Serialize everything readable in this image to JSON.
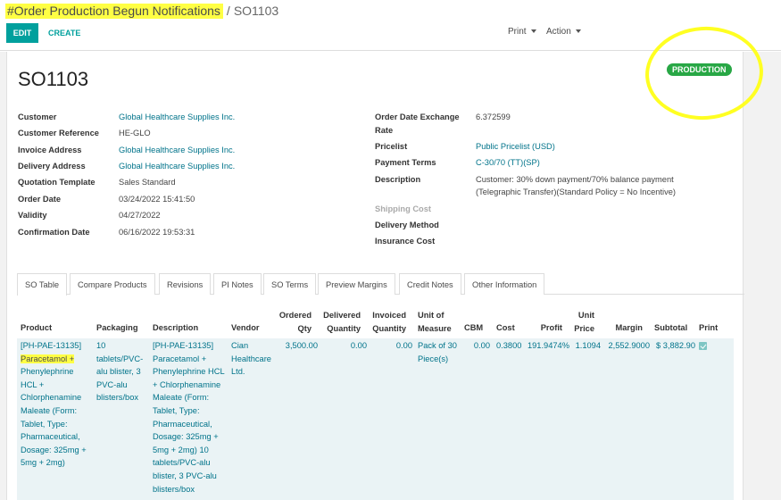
{
  "breadcrumb": {
    "parent": "#Order Production Begun Notifications",
    "separator": "/",
    "current": "SO1103"
  },
  "toolbar": {
    "edit_label": "EDIT",
    "create_label": "CREATE",
    "print_label": "Print",
    "action_label": "Action"
  },
  "record": {
    "name": "SO1103",
    "status": "PRODUCTION",
    "left_fields": [
      {
        "label": "Customer",
        "value": "Global Healthcare Supplies Inc."
      },
      {
        "label": "Customer Reference",
        "value": "HE-GLO"
      },
      {
        "label": "Invoice Address",
        "value": "Global Healthcare Supplies Inc."
      },
      {
        "label": "Delivery Address",
        "value": "Global Healthcare Supplies Inc."
      },
      {
        "label": "Quotation Template",
        "value": "Sales Standard"
      },
      {
        "label": "Order Date",
        "value": "03/24/2022 15:41:50"
      },
      {
        "label": "Validity",
        "value": "04/27/2022"
      },
      {
        "label": "Confirmation Date",
        "value": "06/16/2022 19:53:31"
      }
    ],
    "right_fields": {
      "exchange_rate": {
        "label_line1": "Order Date Exchange",
        "label_line2": "Rate",
        "value": "6.372599"
      },
      "pricelist": {
        "label": "Pricelist",
        "value": "Public Pricelist (USD)"
      },
      "payment_terms": {
        "label": "Payment Terms",
        "value": "C-30/70 (TT)(SP)"
      },
      "description": {
        "label": "Description",
        "line1": "Customer: 30% down payment/70% balance payment",
        "line2": "(Telegraphic Transfer)(Standard Policy = No Incentive)"
      },
      "shipping_cost": {
        "label": "Shipping Cost"
      },
      "delivery_method": {
        "label": "Delivery Method"
      },
      "insurance_cost": {
        "label": "Insurance Cost"
      }
    }
  },
  "tabs": [
    "SO Table",
    "Compare Products",
    "Revisions",
    "PI Notes",
    "SO Terms",
    "Preview Margins",
    "Credit Notes",
    "Other Information"
  ],
  "table": {
    "headers": {
      "product": "Product",
      "packaging": "Packaging",
      "description": "Description",
      "vendor": "Vendor",
      "ordered_qty": [
        "Ordered",
        "Qty"
      ],
      "delivered_qty": [
        "Delivered",
        "Quantity"
      ],
      "invoiced_qty": [
        "Invoiced",
        "Quantity"
      ],
      "unit_of_measure": [
        "Unit of",
        "Measure"
      ],
      "cbm": "CBM",
      "cost": "Cost",
      "profit": "Profit",
      "unit_price": [
        "Unit",
        "Price"
      ],
      "margin": "Margin",
      "subtotal": "Subtotal",
      "print": "Print"
    },
    "row": {
      "product_lines": [
        "[PH-PAE-13135]",
        "Paracetamol +",
        "Phenylephrine",
        "HCL +",
        "Chlorphenamine",
        "Maleate (Form:",
        "Tablet, Type:",
        "Pharmaceutical,",
        "Dosage: 325mg +",
        "5mg + 2mg)"
      ],
      "packaging_lines": [
        "10",
        "tablets/PVC-",
        "alu blister, 3",
        "PVC-alu",
        "blisters/box"
      ],
      "description_lines": [
        "[PH-PAE-13135]",
        "Paracetamol +",
        "Phenylephrine HCL",
        "+ Chlorphenamine",
        "Maleate (Form:",
        "Tablet, Type:",
        "Pharmaceutical,",
        "Dosage: 325mg +",
        "5mg + 2mg) 10",
        "tablets/PVC-alu",
        "blister, 3 PVC-alu",
        "blisters/box"
      ],
      "vendor_lines": [
        "Cian",
        "Healthcare",
        "Ltd."
      ],
      "ordered_qty": "3,500.00",
      "delivered_qty": "0.00",
      "invoiced_qty": "0.00",
      "uom_lines": [
        "Pack of 30",
        "Piece(s)"
      ],
      "cbm": "0.00",
      "cost": "0.3800",
      "profit": "191.9474%",
      "unit_price": "1.1094",
      "margin": "2,552.9000",
      "subtotal": "$ 3,882.90",
      "print_checked": true
    }
  },
  "colors": {
    "accent": "#00a09d",
    "link": "#00738a",
    "status": "#28a745",
    "highlight": "#ffff44"
  }
}
